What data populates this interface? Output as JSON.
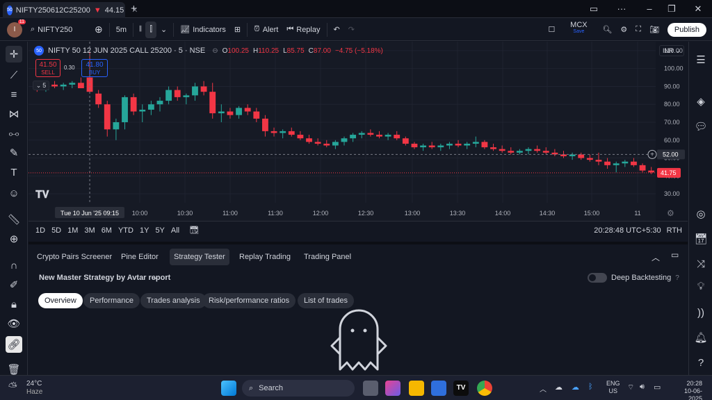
{
  "browser": {
    "tab_title": "NIFTY250612C25200",
    "tab_price": "44.15",
    "tab_badge": "50",
    "new_tab": "+"
  },
  "toolbar": {
    "avatar_letter": "I",
    "notifications": "11",
    "symbol": "NIFTY250",
    "interval": "5m",
    "indicators": "Indicators",
    "alert": "Alert",
    "replay": "Replay",
    "exchange": "MCX",
    "exchange_sub": "Save",
    "publish": "Publish"
  },
  "legend": {
    "badge": "50",
    "title": "NIFTY 50 12 JUN 2025 CALL 25200 · 5 · NSE",
    "o_label": "O",
    "o": "100.25",
    "h_label": "H",
    "h": "110.25",
    "l_label": "L",
    "l": "85.75",
    "c_label": "C",
    "c": "87.00",
    "change": "−4.75 (−5.18%)",
    "sell_price": "41.50",
    "sell": "SELL",
    "spread": "0.30",
    "buy_price": "41.80",
    "buy": "BUY",
    "collapse_count": "5"
  },
  "currency": "INR",
  "chart_data": {
    "type": "candlestick",
    "y_ticks": [
      "110.00",
      "100.00",
      "90.00",
      "80.00",
      "70.00",
      "60.00",
      "50.00",
      "40.00",
      "30.00"
    ],
    "ylim": [
      25,
      115
    ],
    "x_ticks": [
      "10:00",
      "10:30",
      "11:00",
      "11:30",
      "12:00",
      "12:30",
      "13:00",
      "13:30",
      "14:00",
      "14:30",
      "15:00",
      "11"
    ],
    "crosshair_time": "Tue 10 Jun '25  09:15",
    "crosshair_price": "52.00",
    "last_price": "41.75",
    "colors": {
      "up": "#26a69a",
      "down": "#f23645"
    },
    "candles": [
      [
        89,
        91,
        87,
        88
      ],
      [
        88,
        93,
        87,
        91
      ],
      [
        91,
        93,
        89,
        90
      ],
      [
        90,
        92,
        88,
        91
      ],
      [
        91,
        93,
        89,
        92
      ],
      [
        92,
        95,
        90,
        89
      ],
      [
        95,
        110,
        86,
        87
      ],
      [
        86,
        88,
        78,
        80
      ],
      [
        80,
        82,
        62,
        66
      ],
      [
        66,
        72,
        60,
        70
      ],
      [
        70,
        85,
        66,
        84
      ],
      [
        84,
        86,
        74,
        76
      ],
      [
        76,
        80,
        70,
        77
      ],
      [
        77,
        82,
        74,
        80
      ],
      [
        80,
        84,
        76,
        82
      ],
      [
        82,
        90,
        80,
        88
      ],
      [
        88,
        90,
        82,
        84
      ],
      [
        84,
        86,
        80,
        85
      ],
      [
        85,
        92,
        82,
        90
      ],
      [
        90,
        93,
        85,
        87
      ],
      [
        87,
        92,
        72,
        75
      ],
      [
        75,
        80,
        70,
        76
      ],
      [
        76,
        78,
        72,
        74
      ],
      [
        74,
        79,
        72,
        78
      ],
      [
        78,
        80,
        74,
        76
      ],
      [
        76,
        78,
        70,
        72
      ],
      [
        72,
        74,
        62,
        65
      ],
      [
        65,
        67,
        62,
        64
      ],
      [
        64,
        66,
        61,
        65
      ],
      [
        65,
        67,
        62,
        63
      ],
      [
        63,
        65,
        60,
        61
      ],
      [
        61,
        63,
        58,
        59
      ],
      [
        59,
        61,
        57,
        58
      ],
      [
        58,
        60,
        56,
        57
      ],
      [
        57,
        60,
        55,
        59
      ],
      [
        59,
        62,
        57,
        61
      ],
      [
        61,
        64,
        59,
        63
      ],
      [
        63,
        65,
        61,
        64
      ],
      [
        64,
        66,
        62,
        63
      ],
      [
        63,
        65,
        61,
        62
      ],
      [
        62,
        64,
        60,
        63
      ],
      [
        63,
        65,
        60,
        61
      ],
      [
        61,
        62,
        57,
        58
      ],
      [
        58,
        59,
        55,
        56
      ],
      [
        56,
        58,
        54,
        57
      ],
      [
        57,
        59,
        55,
        56
      ],
      [
        56,
        58,
        54,
        57
      ],
      [
        57,
        59,
        55,
        58
      ],
      [
        58,
        60,
        56,
        57
      ],
      [
        57,
        59,
        55,
        58
      ],
      [
        58,
        62,
        56,
        59
      ],
      [
        59,
        60,
        55,
        56
      ],
      [
        56,
        58,
        54,
        55
      ],
      [
        55,
        57,
        53,
        54
      ],
      [
        54,
        56,
        52,
        53
      ],
      [
        53,
        55,
        52,
        54
      ],
      [
        54,
        56,
        52,
        55
      ],
      [
        55,
        57,
        53,
        54
      ],
      [
        54,
        56,
        52,
        53
      ],
      [
        53,
        55,
        51,
        52
      ],
      [
        52,
        54,
        50,
        51
      ],
      [
        51,
        53,
        49,
        52
      ],
      [
        52,
        53,
        49,
        50
      ],
      [
        50,
        52,
        48,
        49
      ],
      [
        49,
        53,
        46,
        48
      ],
      [
        48,
        50,
        44,
        46
      ],
      [
        46,
        48,
        42,
        47
      ],
      [
        47,
        49,
        45,
        48
      ],
      [
        48,
        50,
        45,
        46
      ],
      [
        46,
        47,
        42,
        43
      ],
      [
        43,
        45,
        41,
        42
      ]
    ]
  },
  "rangebar": {
    "ranges": [
      "1D",
      "5D",
      "1M",
      "3M",
      "6M",
      "YTD",
      "1Y",
      "5Y",
      "All"
    ],
    "clock": "20:28:48 UTC+5:30",
    "mode": "RTH"
  },
  "panel": {
    "tabs": [
      "Crypto Pairs Screener",
      "Pine Editor",
      "Strategy Tester",
      "Replay Trading",
      "Trading Panel"
    ],
    "strategy_name": "New Master Strategy by Avtar report",
    "deep_backtesting": "Deep Backtesting",
    "subtabs": [
      "Overview",
      "Performance",
      "Trades analysis",
      "Risk/performance ratios",
      "List of trades"
    ]
  },
  "taskbar": {
    "weather_temp": "24°C",
    "weather_desc": "Haze",
    "search": "Search",
    "lang1": "ENG",
    "lang2": "US",
    "time": "20:28",
    "date": "10-06-2025"
  }
}
